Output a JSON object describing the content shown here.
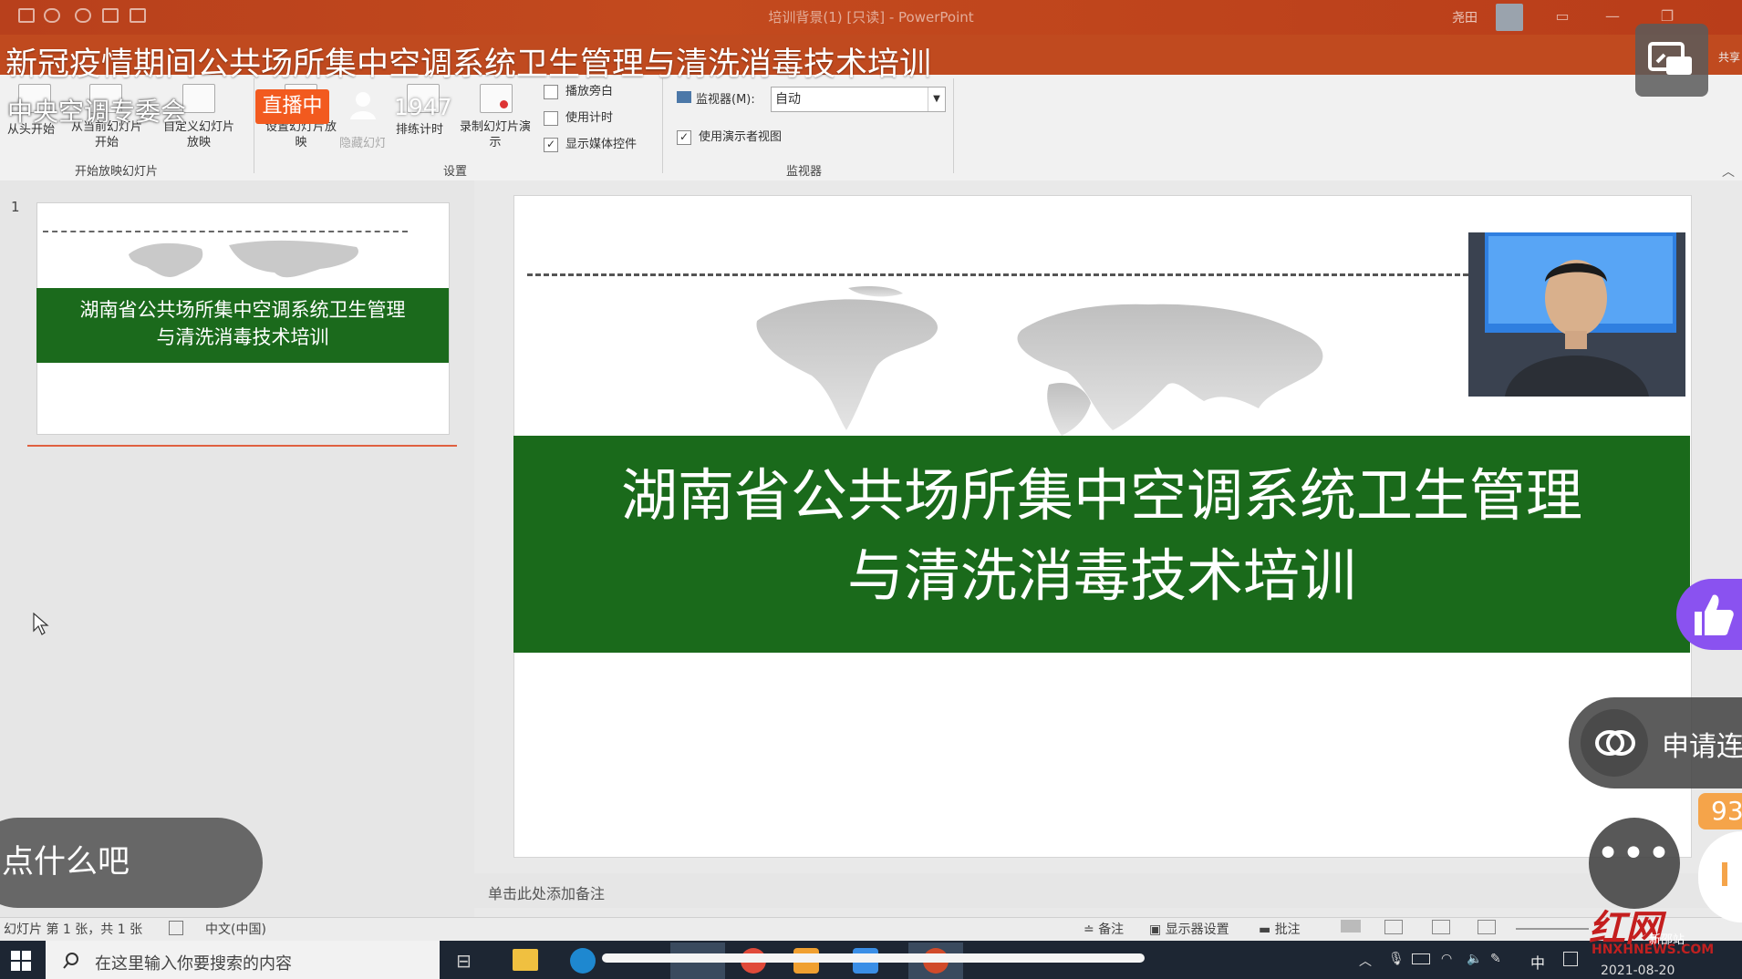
{
  "window": {
    "title": "培训背景(1) [只读] - PowerPoint",
    "user": "尧田"
  },
  "stream": {
    "title": "新冠疫情期间公共场所集中空调系统卫生管理与清洗消毒技术培训",
    "channel": "中央空调专委会",
    "live_label": "直播中",
    "viewers": "1947",
    "like_count": "93",
    "apply_label": "申请连",
    "chat_placeholder": "点什么吧",
    "share_label": "共享",
    "watermark_text": "红网",
    "watermark_sub": "新邵站",
    "watermark_site": "HNXHNEWS.COM"
  },
  "ribbon": {
    "group_start": {
      "label": "开始放映幻灯片",
      "from_start": "从头开始",
      "from_current": "从当前幻灯片开始",
      "custom": "自定义幻灯片放映"
    },
    "group_setup": {
      "label": "设置",
      "setup": "设置幻灯片放映",
      "hide": "隐藏幻灯片",
      "rehearse": "排练计时",
      "record": "录制幻灯片演示",
      "play_narration": "播放旁白",
      "use_timing": "使用计时",
      "show_media": "显示媒体控件"
    },
    "group_monitor": {
      "label": "监视器",
      "monitor_label": "监视器(M):",
      "monitor_value": "自动",
      "presenter_view": "使用演示者视图"
    }
  },
  "thumbnails": [
    {
      "number": "1",
      "title_line1": "湖南省公共场所集中空调系统卫生管理",
      "title_line2": "与清洗消毒技术培训"
    }
  ],
  "slide": {
    "title_line1": "湖南省公共场所集中空调系统卫生管理",
    "title_line2": "与清洗消毒技术培训"
  },
  "notes": {
    "placeholder": "单击此处添加备注"
  },
  "statusbar": {
    "slide_info": "幻灯片 第 1 张，共 1 张",
    "language": "中文(中国)",
    "notes": "备注",
    "display_settings": "显示器设置",
    "comments": "批注"
  },
  "taskbar": {
    "search_placeholder": "在这里输入你要搜索的内容",
    "ime": "中",
    "date": "2021-08-20"
  },
  "colors": {
    "ribbon_accent": "#c04a1f",
    "slide_band": "#1a6a1b",
    "live_badge": "#f25a1f",
    "like_button": "#8a52f0"
  }
}
